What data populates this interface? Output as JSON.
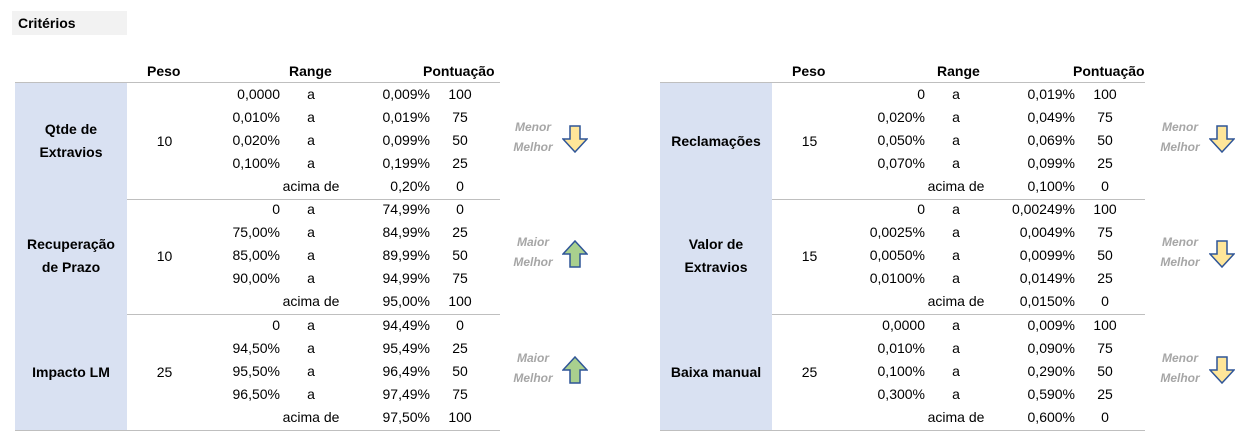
{
  "title": "Critérios",
  "headers": {
    "peso": "Peso",
    "range": "Range",
    "pontuacao": "Pontuação"
  },
  "left": [
    {
      "name": "Qtde de\nExtravios",
      "peso": "10",
      "direction": "Menor\nMelhor",
      "arrow": "down-arrow-icon",
      "rows": [
        {
          "low": "0,0000",
          "sep": "a",
          "high": "0,009%",
          "pts": "100"
        },
        {
          "low": "0,010%",
          "sep": "a",
          "high": "0,019%",
          "pts": "75"
        },
        {
          "low": "0,020%",
          "sep": "a",
          "high": "0,099%",
          "pts": "50"
        },
        {
          "low": "0,100%",
          "sep": "a",
          "high": "0,199%",
          "pts": "25"
        },
        {
          "low": "",
          "sep": "acima de",
          "high": "0,20%",
          "pts": "0"
        }
      ]
    },
    {
      "name": "Recuperação\nde Prazo",
      "peso": "10",
      "direction": "Maior\nMelhor",
      "arrow": "up-arrow-icon",
      "rows": [
        {
          "low": "0",
          "sep": "a",
          "high": "74,99%",
          "pts": "0"
        },
        {
          "low": "75,00%",
          "sep": "a",
          "high": "84,99%",
          "pts": "25"
        },
        {
          "low": "85,00%",
          "sep": "a",
          "high": "89,99%",
          "pts": "50"
        },
        {
          "low": "90,00%",
          "sep": "a",
          "high": "94,99%",
          "pts": "75"
        },
        {
          "low": "",
          "sep": "acima de",
          "high": "95,00%",
          "pts": "100"
        }
      ]
    },
    {
      "name": "Impacto LM",
      "peso": "25",
      "direction": "Maior\nMelhor",
      "arrow": "up-arrow-icon",
      "rows": [
        {
          "low": "0",
          "sep": "a",
          "high": "94,49%",
          "pts": "0"
        },
        {
          "low": "94,50%",
          "sep": "a",
          "high": "95,49%",
          "pts": "25"
        },
        {
          "low": "95,50%",
          "sep": "a",
          "high": "96,49%",
          "pts": "50"
        },
        {
          "low": "96,50%",
          "sep": "a",
          "high": "97,49%",
          "pts": "75"
        },
        {
          "low": "",
          "sep": "acima de",
          "high": "97,50%",
          "pts": "100"
        }
      ]
    }
  ],
  "right": [
    {
      "name": "Reclamações",
      "peso": "15",
      "direction": "Menor\nMelhor",
      "arrow": "down-arrow-icon",
      "rows": [
        {
          "low": "0",
          "sep": "a",
          "high": "0,019%",
          "pts": "100"
        },
        {
          "low": "0,020%",
          "sep": "a",
          "high": "0,049%",
          "pts": "75"
        },
        {
          "low": "0,050%",
          "sep": "a",
          "high": "0,069%",
          "pts": "50"
        },
        {
          "low": "0,070%",
          "sep": "a",
          "high": "0,099%",
          "pts": "25"
        },
        {
          "low": "",
          "sep": "acima de",
          "high": "0,100%",
          "pts": "0"
        }
      ]
    },
    {
      "name": "Valor de\nExtravios",
      "peso": "15",
      "direction": "Menor\nMelhor",
      "arrow": "down-arrow-icon",
      "rows": [
        {
          "low": "0",
          "sep": "a",
          "high": "0,00249%",
          "pts": "100"
        },
        {
          "low": "0,0025%",
          "sep": "a",
          "high": "0,0049%",
          "pts": "75"
        },
        {
          "low": "0,0050%",
          "sep": "a",
          "high": "0,0099%",
          "pts": "50"
        },
        {
          "low": "0,0100%",
          "sep": "a",
          "high": "0,0149%",
          "pts": "25"
        },
        {
          "low": "",
          "sep": "acima de",
          "high": "0,0150%",
          "pts": "0"
        }
      ]
    },
    {
      "name": "Baixa manual",
      "peso": "25",
      "direction": "Menor\nMelhor",
      "arrow": "down-arrow-icon",
      "rows": [
        {
          "low": "0,0000",
          "sep": "a",
          "high": "0,009%",
          "pts": "100"
        },
        {
          "low": "0,010%",
          "sep": "a",
          "high": "0,090%",
          "pts": "75"
        },
        {
          "low": "0,100%",
          "sep": "a",
          "high": "0,290%",
          "pts": "50"
        },
        {
          "low": "0,300%",
          "sep": "a",
          "high": "0,590%",
          "pts": "25"
        },
        {
          "low": "",
          "sep": "acima de",
          "high": "0,600%",
          "pts": "0"
        }
      ]
    }
  ],
  "colors": {
    "name_fill": "#d9e1f2",
    "down_arrow_fill": "#ffe699",
    "up_arrow_fill": "#a9d08e",
    "arrow_stroke": "#2f5597",
    "direction_text": "#a6a6a6"
  }
}
